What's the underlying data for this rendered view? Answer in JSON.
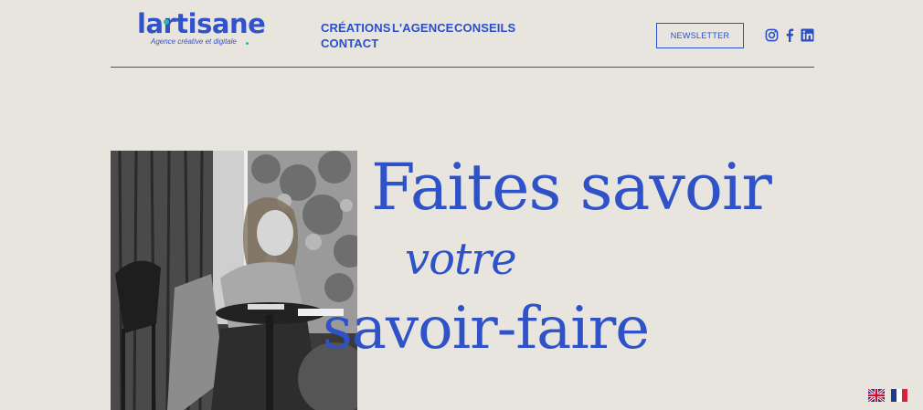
{
  "brand": {
    "name": "lartisane",
    "tagline": "Agence créative et digitale"
  },
  "nav": {
    "items": [
      {
        "label": "CRÉATIONS"
      },
      {
        "label": "L'AGENCE"
      },
      {
        "label": "CONSEILS"
      },
      {
        "label": "CONTACT"
      }
    ]
  },
  "newsletter": {
    "label": "NEWSLETTER"
  },
  "social": [
    "instagram-icon",
    "facebook-icon",
    "linkedin-icon"
  ],
  "hero": {
    "line1": "Faites savoir",
    "line2": "votre",
    "line3": "savoir-faire"
  },
  "languages": [
    "en",
    "fr"
  ],
  "colors": {
    "accent": "#2b4fc7",
    "background": "#e8e5df",
    "logo_dot": "#2ab6a0"
  }
}
